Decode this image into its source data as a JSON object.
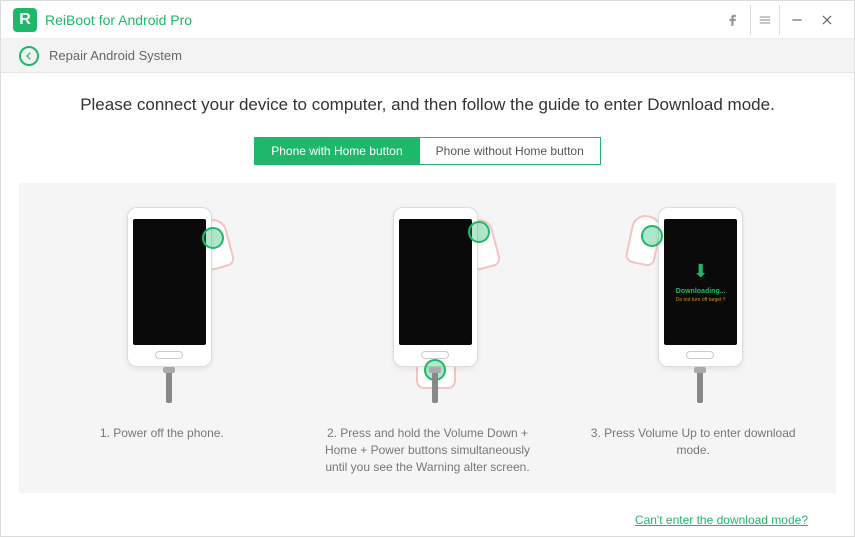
{
  "app": {
    "title": "ReiBoot for Android Pro"
  },
  "subheader": {
    "title": "Repair Android System"
  },
  "main": {
    "instruction": "Please connect your device to computer, and then follow the guide to enter Download mode.",
    "tabs": {
      "with_home": "Phone with Home button",
      "without_home": "Phone without Home button"
    },
    "steps": {
      "step1": "1. Power off the phone.",
      "step2": "2. Press and hold the Volume Down + Home + Power buttons simultaneously until you see the Warning alter screen.",
      "step3": "3. Press Volume Up to enter download mode.",
      "downloading_label": "Downloading...",
      "downloading_warning": "Do not turn off target !!"
    },
    "footer_link": "Can't enter the download mode?"
  }
}
